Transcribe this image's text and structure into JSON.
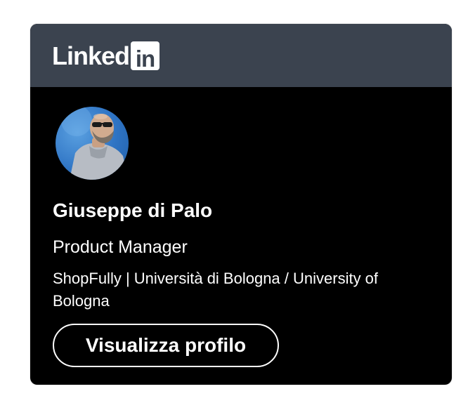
{
  "brand": {
    "wordmark": "Linked",
    "mark": "in",
    "header_color": "#3b434f",
    "card_color": "#000000"
  },
  "profile": {
    "name": "Giuseppe di Palo",
    "headline": "Product Manager",
    "company": "ShopFully | Università di Bologna / University of Bologna",
    "avatar_icon": "profile-photo"
  },
  "actions": {
    "view_profile_label": "Visualizza profilo"
  }
}
